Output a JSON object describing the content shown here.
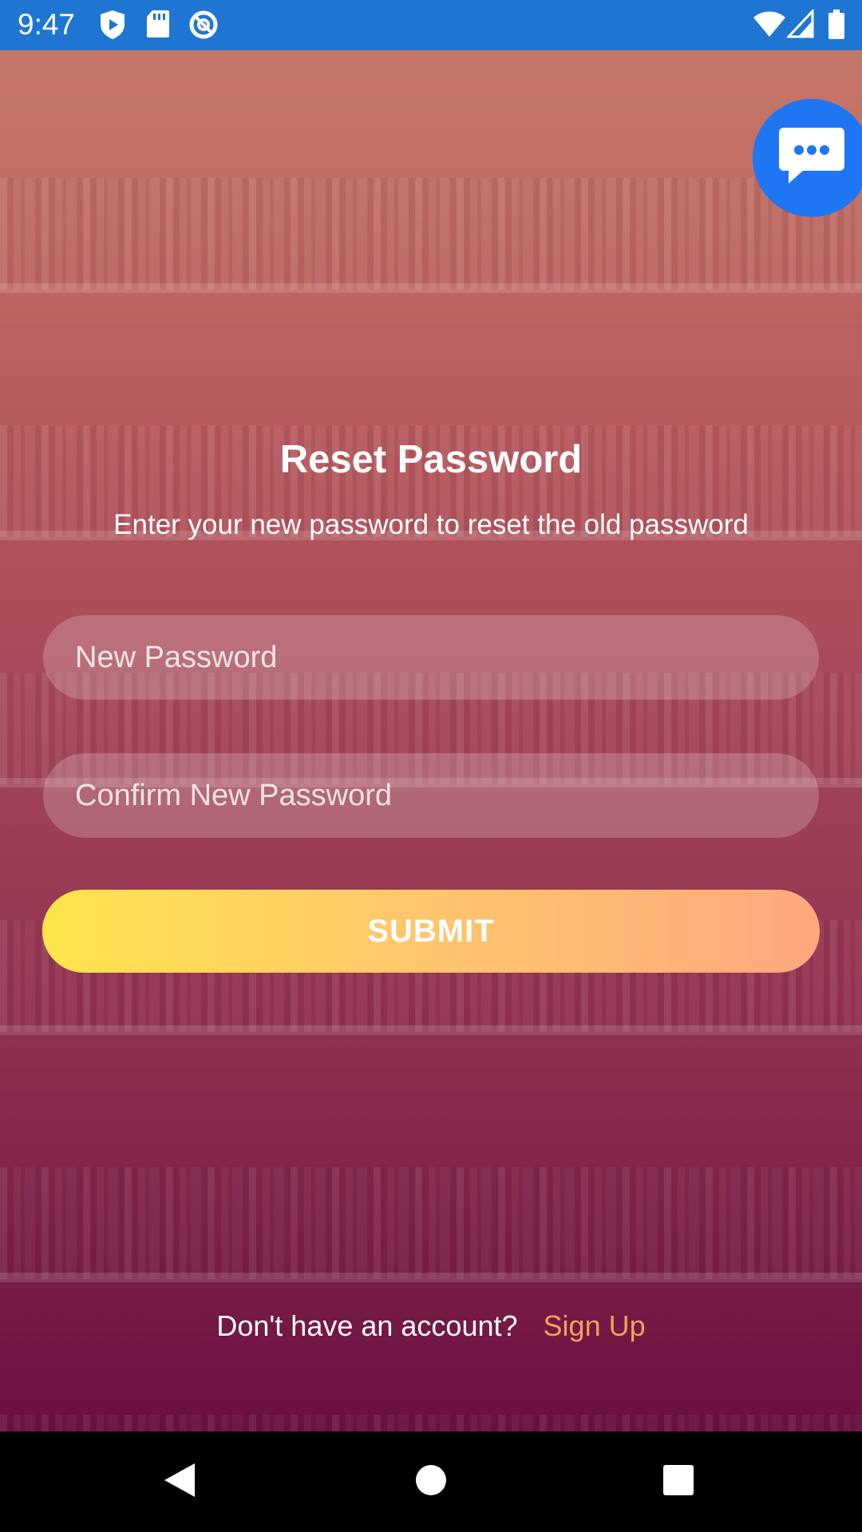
{
  "status_bar": {
    "time": "9:47",
    "left_icons": [
      "play-protect-icon",
      "sd-card-icon",
      "at-sign-icon"
    ],
    "right_icons": [
      "wifi-icon",
      "signal-icon",
      "battery-icon"
    ],
    "background": "#1E76D2"
  },
  "chat_button": {
    "icon": "chat-bubble-dots-icon",
    "color": "#1E76F2"
  },
  "reset": {
    "title": "Reset Password",
    "subtitle": "Enter your new password to reset the old password",
    "new_password_placeholder": "New Password",
    "confirm_password_placeholder": "Confirm New Password",
    "submit_label": "SUBMIT"
  },
  "footer": {
    "prompt": "Don't have an account?",
    "signup_label": "Sign Up",
    "signup_color": "#F3A05A"
  },
  "nav_bar": {
    "buttons": [
      "back-icon",
      "home-icon",
      "recents-icon"
    ]
  },
  "colors": {
    "gradient_top": "#D68070",
    "gradient_bottom": "#701044",
    "submit_gradient_start": "#FFE54C",
    "submit_gradient_end": "#FFA77F"
  }
}
